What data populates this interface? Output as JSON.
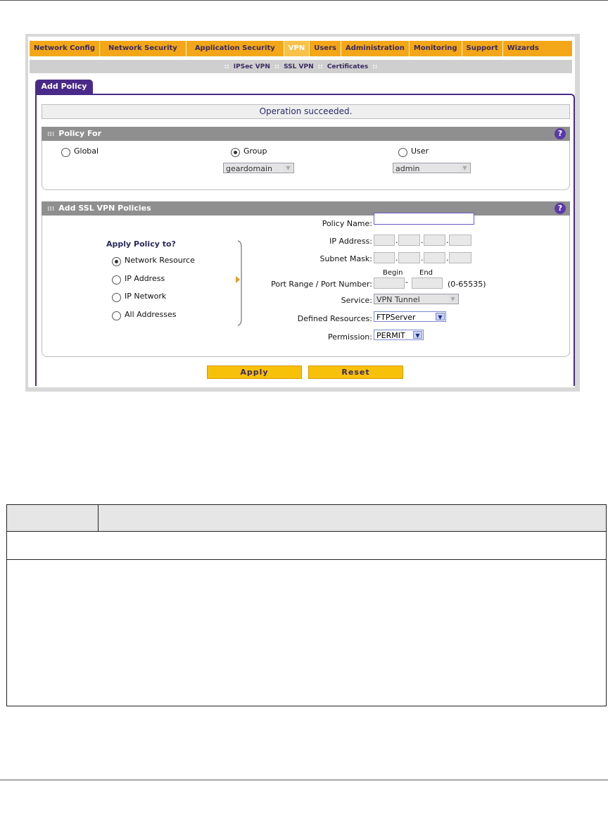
{
  "nav": {
    "items": [
      "Network Config",
      "Network Security",
      "Application Security",
      "VPN",
      "Users",
      "Administration",
      "Monitoring",
      "Support",
      "Wizards"
    ],
    "active": "VPN"
  },
  "subnav": {
    "items": [
      "IPSec VPN",
      "SSL VPN",
      "Certificates"
    ],
    "separator": "::"
  },
  "tab": {
    "label": "Add Policy"
  },
  "status": {
    "message": "Operation succeeded."
  },
  "policy_for": {
    "heading": "Policy For",
    "options": [
      "Global",
      "Group",
      "User"
    ],
    "selected": "Group",
    "group_select": "geardomain",
    "user_select": "admin"
  },
  "add_policies": {
    "heading": "Add SSL VPN Policies",
    "apply_to_title": "Apply Policy to?",
    "apply_to_options": [
      "Network Resource",
      "IP Address",
      "IP Network",
      "All Addresses"
    ],
    "apply_to_selected": "Network Resource",
    "policy_name_label": "Policy Name:",
    "policy_name_value": "",
    "ip_address_label": "IP Address:",
    "subnet_mask_label": "Subnet Mask:",
    "port_range_label": "Port Range / Port Number:",
    "begin_label": "Begin",
    "end_label": "End",
    "port_hint": "(0-65535)",
    "service_label": "Service:",
    "service_value": "VPN Tunnel",
    "defined_resources_label": "Defined Resources:",
    "defined_resources_value": "FTPServer",
    "permission_label": "Permission:",
    "permission_value": "PERMIT"
  },
  "buttons": {
    "apply": "Apply",
    "reset": "Reset"
  },
  "help_icon": "question-mark-icon",
  "colors": {
    "nav": "#f3a718",
    "accent": "#4a2a88",
    "button": "#f7c10a"
  }
}
